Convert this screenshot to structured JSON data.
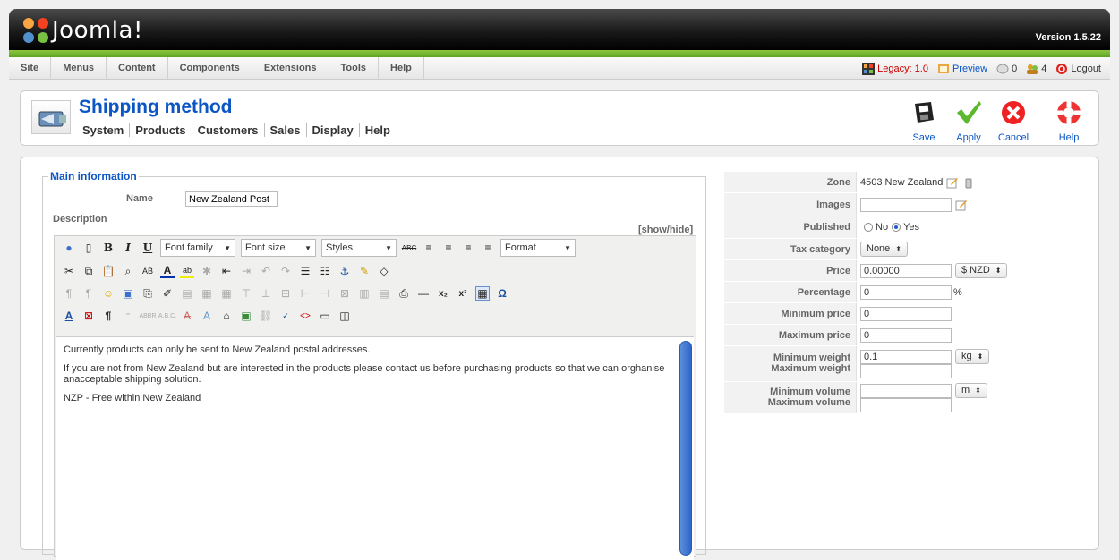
{
  "header": {
    "logo_text": "Joomla!",
    "version": "Version 1.5.22"
  },
  "menu": {
    "items": [
      "Site",
      "Menus",
      "Content",
      "Components",
      "Extensions",
      "Tools",
      "Help"
    ]
  },
  "status": {
    "legacy": "Legacy: 1.0",
    "preview": "Preview",
    "messages": "0",
    "users": "4",
    "logout": "Logout"
  },
  "title": {
    "text": "Shipping method"
  },
  "submenu": {
    "items": [
      "System",
      "Products",
      "Customers",
      "Sales",
      "Display",
      "Help"
    ]
  },
  "toolbar": {
    "save": "Save",
    "apply": "Apply",
    "cancel": "Cancel",
    "help": "Help"
  },
  "form": {
    "legend": "Main information",
    "name_label": "Name",
    "name_value": "New Zealand Post",
    "description_label": "Description",
    "showhide": "[show/hide]",
    "editor_selects": {
      "font_family": "Font family",
      "font_size": "Font size",
      "styles": "Styles",
      "format": "Format"
    },
    "description_paragraphs": [
      "Currently products can only be sent to New Zealand postal addresses.",
      "If you are not from New Zealand but are interested in the products please contact us before purchasing products so that we can orghanise anacceptable shipping solution.",
      "NZP - Free within New Zealand"
    ]
  },
  "props": {
    "zone_label": "Zone",
    "zone_value": "4503 New Zealand",
    "images_label": "Images",
    "published_label": "Published",
    "published_no": "No",
    "published_yes": "Yes",
    "tax_label": "Tax category",
    "tax_value": "None",
    "price_label": "Price",
    "price_value": "0.00000",
    "currency": "$ NZD",
    "percentage_label": "Percentage",
    "percentage_value": "0",
    "percent_sign": "%",
    "min_price_label": "Minimum price",
    "min_price_value": "0",
    "max_price_label": "Maximum price",
    "max_price_value": "0",
    "min_weight_label": "Minimum weight",
    "max_weight_label": "Maximum weight",
    "min_weight_value": "0.1",
    "weight_unit": "kg",
    "min_volume_label": "Minimum volume",
    "max_volume_label": "Maximum volume",
    "volume_unit": "m"
  },
  "colors": {
    "accent": "#0b55c4",
    "green": "#7ac143",
    "header_dark": "#1a1a1a"
  }
}
